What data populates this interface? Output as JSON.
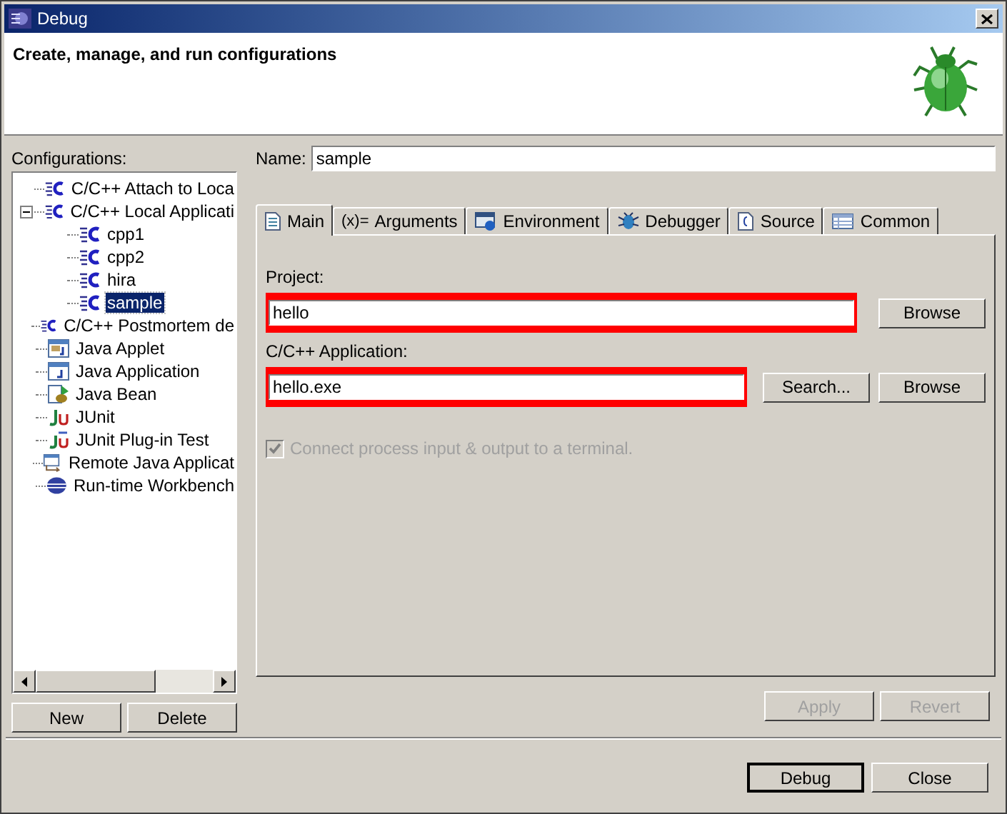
{
  "window": {
    "title": "Debug"
  },
  "header": {
    "title": "Create, manage, and run configurations"
  },
  "configurations": {
    "label": "Configurations:",
    "items": [
      {
        "label": "C/C++ Attach to Loca",
        "kind": "c",
        "selected": false
      },
      {
        "label": "C/C++ Local Applicati",
        "kind": "c",
        "selected": false,
        "expanded": true,
        "children": [
          {
            "label": "cpp1",
            "kind": "c",
            "selected": false
          },
          {
            "label": "cpp2",
            "kind": "c",
            "selected": false
          },
          {
            "label": "hira",
            "kind": "c",
            "selected": false
          },
          {
            "label": "sample",
            "kind": "c",
            "selected": true
          }
        ]
      },
      {
        "label": "C/C++ Postmortem de",
        "kind": "c",
        "selected": false
      },
      {
        "label": "Java Applet",
        "kind": "applet",
        "selected": false
      },
      {
        "label": "Java Application",
        "kind": "app",
        "selected": false
      },
      {
        "label": "Java Bean",
        "kind": "bean",
        "selected": false
      },
      {
        "label": "JUnit",
        "kind": "junit",
        "selected": false
      },
      {
        "label": "JUnit Plug-in Test",
        "kind": "plugin",
        "selected": false
      },
      {
        "label": "Remote Java Applicat",
        "kind": "remote",
        "selected": false
      },
      {
        "label": "Run-time Workbench",
        "kind": "workbench",
        "selected": false
      }
    ],
    "buttons": [
      {
        "label": "New",
        "disabled": false
      },
      {
        "label": "Delete",
        "disabled": false
      }
    ]
  },
  "name": {
    "label": "Name:",
    "value": "sample"
  },
  "tabs": [
    {
      "label": "Main",
      "kind": "main",
      "selected": true
    },
    {
      "label": "Arguments",
      "kind": "arguments",
      "icon_text": "(x)=",
      "selected": false
    },
    {
      "label": "Environment",
      "kind": "environment",
      "selected": false
    },
    {
      "label": "Debugger",
      "kind": "debugger",
      "selected": false
    },
    {
      "label": "Source",
      "kind": "source",
      "selected": false
    },
    {
      "label": "Common",
      "kind": "common",
      "selected": false
    }
  ],
  "main": {
    "project": {
      "label": "Project:",
      "value": "hello",
      "highlighted": true,
      "buttons": [
        "Browse"
      ]
    },
    "application": {
      "label": "C/C++ Application:",
      "value": "hello.exe",
      "highlighted": true,
      "buttons": [
        "Search...",
        "Browse"
      ]
    },
    "terminal": {
      "label": "Connect process input & output to a terminal.",
      "checked": true,
      "disabled": true
    }
  },
  "panel_buttons": [
    {
      "label": "Apply",
      "disabled": true
    },
    {
      "label": "Revert",
      "disabled": true
    }
  ],
  "dialog_buttons": [
    {
      "label": "Debug",
      "default": true
    },
    {
      "label": "Close",
      "default": false
    }
  ]
}
